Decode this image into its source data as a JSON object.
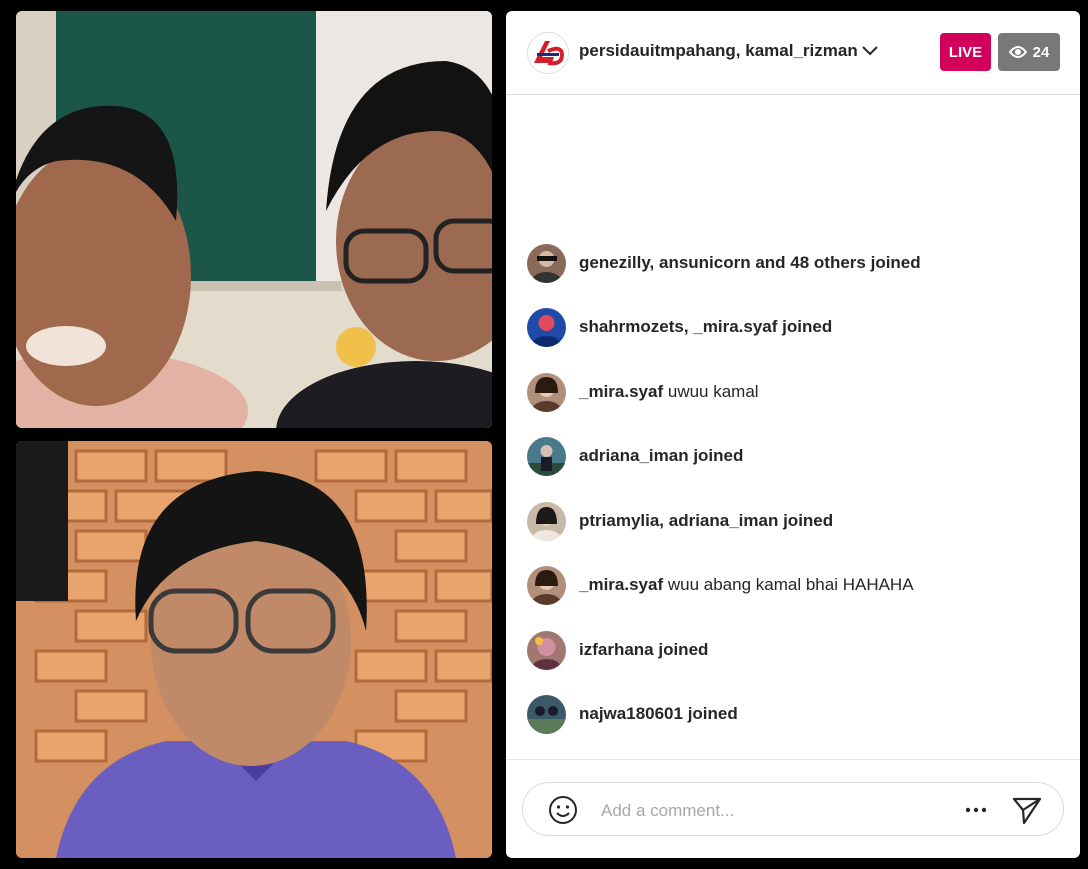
{
  "header": {
    "host_names": "persidauitmpahang, kamal_rizman",
    "live_label": "LIVE",
    "viewer_count": "24"
  },
  "comments": [
    {
      "user": "genezilly, ansunicorn and 48 others joined",
      "text": "",
      "avatar_color": "#8a6a5a"
    },
    {
      "user": "shahrmozets, _mira.syaf joined",
      "text": "",
      "avatar_color": "#1f4aa8"
    },
    {
      "user": "_mira.syaf",
      "text": "uwuu kamal",
      "avatar_color": "#b0907a"
    },
    {
      "user": "adriana_iman joined",
      "text": "",
      "avatar_color": "#4a7a8a"
    },
    {
      "user": "ptriamylia, adriana_iman joined",
      "text": "",
      "avatar_color": "#c8b8a8"
    },
    {
      "user": "_mira.syaf",
      "text": "wuu abang kamal bhai HAHAHA",
      "avatar_color": "#b0907a"
    },
    {
      "user": "izfarhana joined",
      "text": "",
      "avatar_color": "#a07870"
    },
    {
      "user": "najwa180601 joined",
      "text": "",
      "avatar_color": "#3a5a6a"
    }
  ],
  "footer": {
    "placeholder": "Add a comment..."
  },
  "colors": {
    "live": "#d3005b",
    "viewer_badge": "#787878"
  },
  "icons": [
    "chevron-down-icon",
    "eye-icon",
    "emoji-icon",
    "more-icon",
    "send-icon"
  ]
}
